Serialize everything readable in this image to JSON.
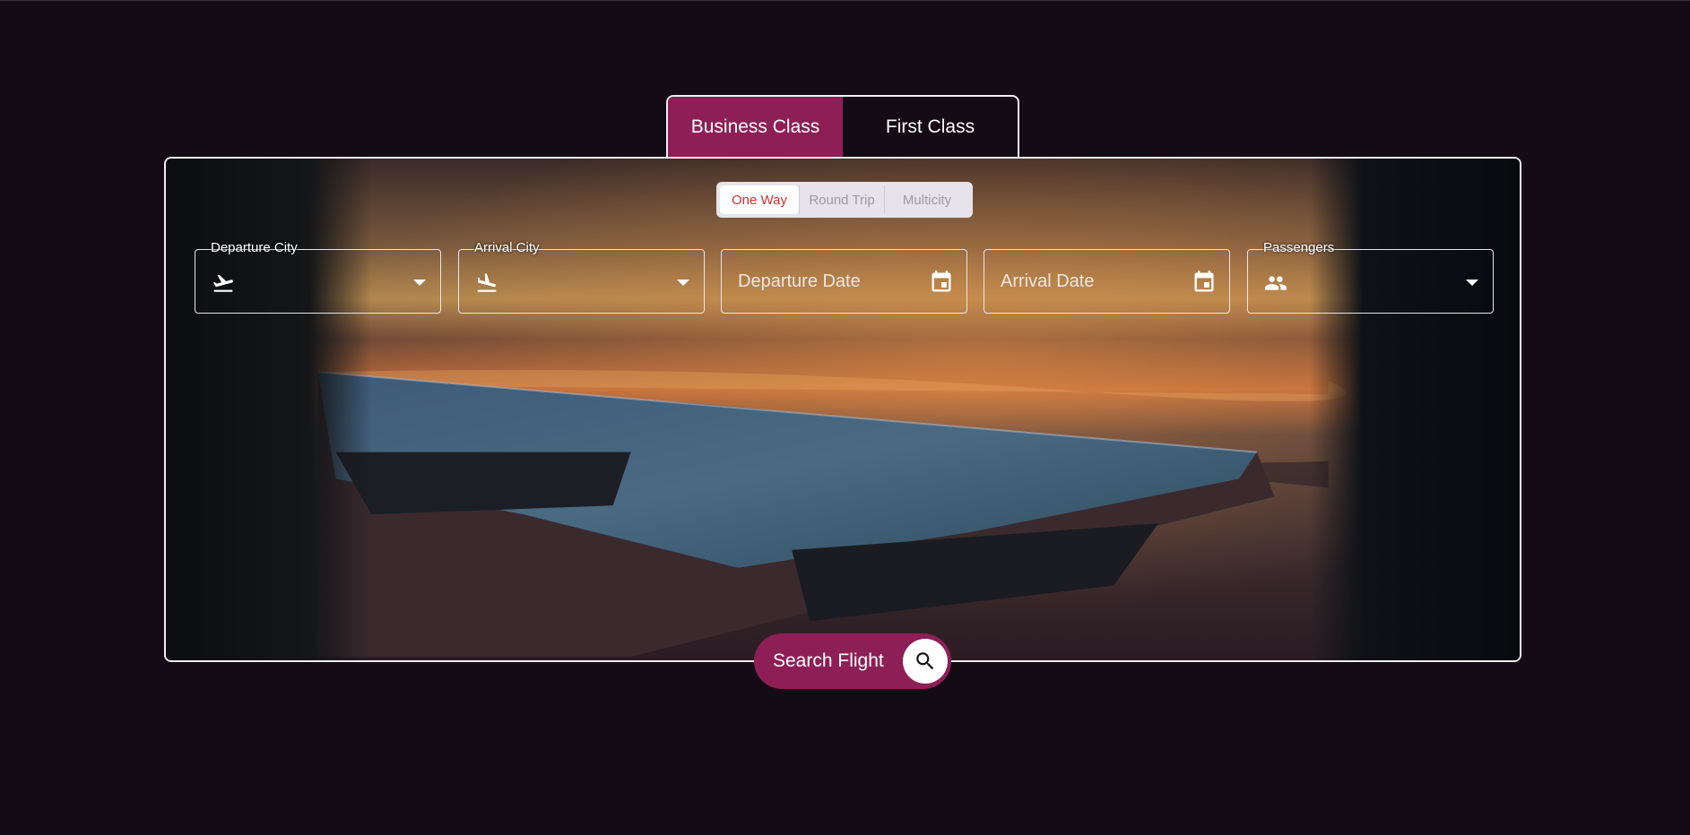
{
  "class_tabs": [
    {
      "label": "Business Class",
      "active": true
    },
    {
      "label": "First Class",
      "active": false
    }
  ],
  "trip_types": [
    {
      "label": "One Way",
      "active": true
    },
    {
      "label": "Round Trip",
      "active": false
    },
    {
      "label": "Multicity",
      "active": false
    }
  ],
  "fields": {
    "departure_city": {
      "label": "Departure City",
      "icon": "flight-takeoff-icon"
    },
    "arrival_city": {
      "label": "Arrival City",
      "icon": "flight-land-icon"
    },
    "departure_date": {
      "placeholder": "Departure Date",
      "icon": "calendar-icon"
    },
    "arrival_date": {
      "placeholder": "Arrival Date",
      "icon": "calendar-icon"
    },
    "passengers": {
      "label": "Passengers",
      "icon": "people-icon"
    }
  },
  "search_button": {
    "label": "Search Flight",
    "icon": "search-icon"
  },
  "colors": {
    "accent": "#8e1f56",
    "background": "#150b15",
    "active_trip_text": "#c8322f"
  }
}
